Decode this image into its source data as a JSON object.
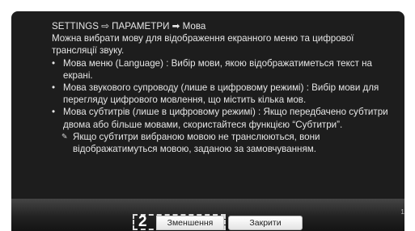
{
  "header": {
    "breadcrumb": "SETTINGS ⇨ ПАРАМЕТРИ ➡ Мова"
  },
  "intro": "Можна вибрати мову для відображення екранного меню та цифрової трансляції звуку.",
  "items": [
    {
      "bullet": "•",
      "text": "Мова меню (Language) : Вибір мови, якою відображатиметься текст на екрані."
    },
    {
      "bullet": "•",
      "text": "Мова звукового супроводу (лише в цифровому режимі) : Вибір мови для перегляду цифрового мовлення, що містить кілька мов."
    },
    {
      "bullet": "•",
      "text": "Мова субтитрів (лише в цифровому режимі) : Якщо передбачено субтитри двома або більше мовами, скористайтеся функцією “Субтитри”."
    }
  ],
  "note": {
    "icon": "✎",
    "text": "Якщо субтитри вибраною мовою не транслюються, вони відображатимуться мовою, заданою за замовчуванням."
  },
  "footer": {
    "step_number": "2",
    "reduce_label": "Зменшення",
    "close_label": "Закрити",
    "page_indicator": "1/"
  }
}
